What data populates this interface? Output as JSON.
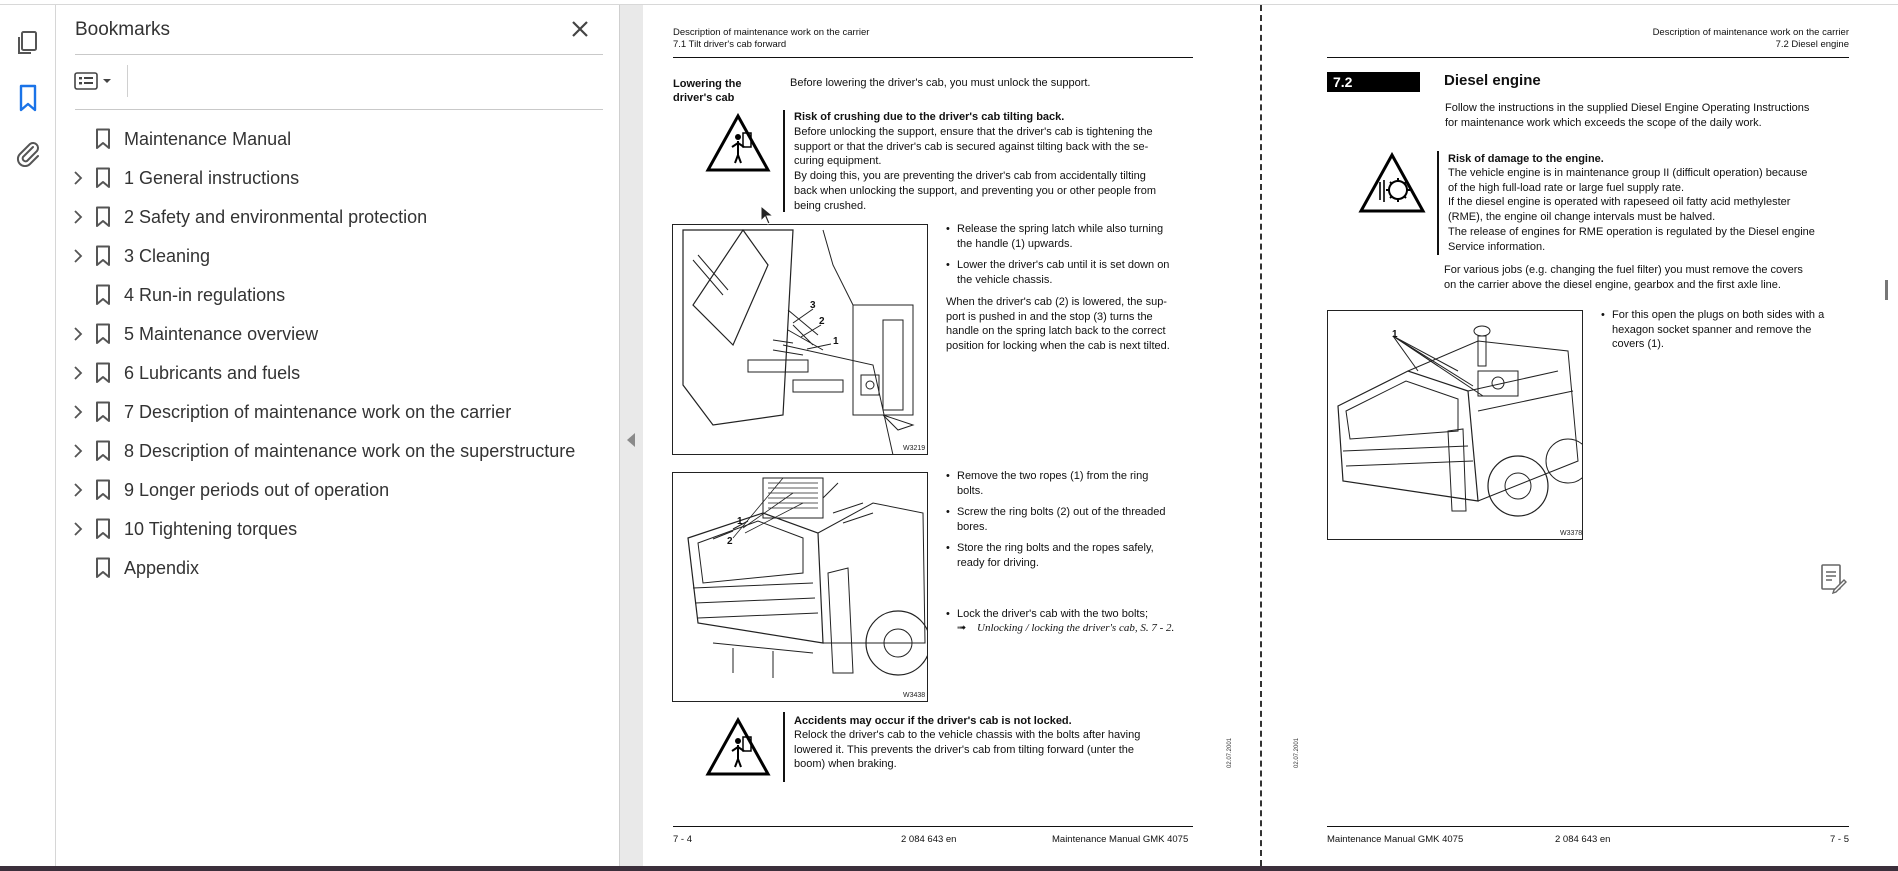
{
  "panel": {
    "title": "Bookmarks",
    "bookmarks": [
      {
        "label": "Maintenance Manual",
        "expandable": false
      },
      {
        "label": "1 General instructions",
        "expandable": true
      },
      {
        "label": "2 Safety and environmental protection",
        "expandable": true
      },
      {
        "label": "3 Cleaning",
        "expandable": true
      },
      {
        "label": "4 Run-in regulations",
        "expandable": false
      },
      {
        "label": "5 Maintenance overview",
        "expandable": true
      },
      {
        "label": "6 Lubricants and fuels",
        "expandable": true
      },
      {
        "label": "7 Description of maintenance work on the carrier",
        "expandable": true
      },
      {
        "label": "8 Description of maintenance work on the superstructure",
        "expandable": true
      },
      {
        "label": "9 Longer periods out of operation",
        "expandable": true
      },
      {
        "label": "10 Tightening torques",
        "expandable": true
      },
      {
        "label": "Appendix",
        "expandable": false
      }
    ]
  },
  "rail": {
    "icons": [
      "pages-icon",
      "bookmark-icon",
      "attachment-icon"
    ]
  },
  "left_page": {
    "header_1": "Description of maintenance work on the carrier",
    "header_2": "7.1 Tilt driver's cab forward",
    "side_head_1": "Lowering the",
    "side_head_2": "driver's cab",
    "intro": "Before lowering the driver's cab, you must unlock the support.",
    "warn1_title": "Risk of crushing due to the driver's cab tilting back.",
    "warn1_lines": [
      "Before unlocking the support, ensure that the driver's cab is tightening the",
      "support or that the driver's cab is secured against tilting back with the se-",
      "curing equipment.",
      "By doing this, you are preventing the driver's cab from accidentally tilting",
      "back when unlocking the support, and preventing you or other people from",
      "being crushed."
    ],
    "bullets_a": [
      [
        "Release the spring latch while also turning",
        "the handle (1) upwards."
      ],
      [
        "Lower the driver's cab until it is set down on",
        "the vehicle chassis."
      ]
    ],
    "para_a": [
      "When the driver's cab (2) is lowered, the sup-",
      "port is pushed in and the stop (3) turns the",
      "handle on the spring latch back to the correct",
      "position for locking when the cab is next tilted."
    ],
    "fig1_code": "W3219",
    "fig1_labels": [
      "3",
      "2",
      "1"
    ],
    "bullets_b": [
      [
        "Remove the two ropes (1) from the ring",
        "bolts."
      ],
      [
        "Screw the ring bolts (2) out of the threaded",
        "bores."
      ],
      [
        "Store the ring bolts and the ropes safely,",
        "ready for driving."
      ]
    ],
    "bullet_c": "Lock the driver's cab with the two bolts;",
    "xref_arrow": "➟",
    "xref": "Unlocking / locking the driver's cab, S. 7 - 2.",
    "fig2_code": "W3438",
    "fig2_labels": [
      "1",
      "2"
    ],
    "warn2_title": "Accidents may occur if the driver's cab is not locked.",
    "warn2_lines": [
      "Relock the driver's cab to the vehicle chassis with the bolts after having",
      "lowered it. This prevents the driver's cab from tilting forward (unter the",
      "boom) when braking."
    ],
    "margin_code": "02.07.2001",
    "footer_page": "7 - 4",
    "footer_code": "2 084 643 en",
    "footer_title": "Maintenance Manual GMK 4075"
  },
  "right_page": {
    "header_1": "Description of maintenance work on the carrier",
    "header_2": "7.2 Diesel engine",
    "section_num": "7.2",
    "section_title": "Diesel engine",
    "intro": [
      "Follow the instructions in the supplied Diesel Engine Operating Instructions",
      "for maintenance work which exceeds the scope of the daily work."
    ],
    "warn_title": "Risk of damage to the engine.",
    "warn_lines": [
      "The vehicle engine is in maintenance group II (difficult operation) because",
      "of the high full-load rate or large fuel supply rate.",
      "If the diesel engine is operated with rapeseed oil fatty acid methylester",
      "(RME), the engine oil change intervals must be halved.",
      "The release of engines for RME operation is regulated by the Diesel engine",
      "Service information."
    ],
    "para": [
      "For various jobs (e.g. changing the fuel filter) you must remove the covers",
      "on the carrier above the diesel engine, gearbox and the first axle line."
    ],
    "bullet": [
      "For this open the plugs on both sides with a",
      "hexagon socket spanner and remove the",
      "covers (1)."
    ],
    "fig_code": "W3378",
    "fig_label": "1",
    "margin_code": "02.07.2001",
    "footer_title": "Maintenance Manual GMK 4075",
    "footer_code": "2 084 643 en",
    "footer_page": "7 - 5"
  }
}
